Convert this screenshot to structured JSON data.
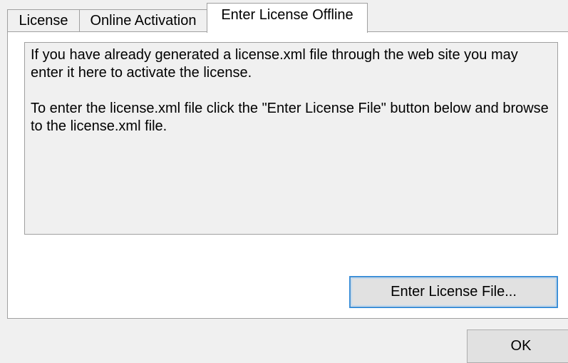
{
  "tabs": [
    {
      "label": "License",
      "selected": false
    },
    {
      "label": "Online Activation",
      "selected": false
    },
    {
      "label": "Enter License Offline",
      "selected": true
    }
  ],
  "panel": {
    "description_1": "If you have already generated a license.xml file through the web site you may enter it here to activate the license.",
    "description_2": "To enter the license.xml file click the \"Enter License File\" button below and browse to the license.xml file.",
    "enter_button_label": "Enter License File..."
  },
  "footer": {
    "ok_label": "OK"
  },
  "colors": {
    "window_background": "#f0f0f0",
    "panel_background": "#ffffff",
    "focus_border": "#3c8fd8"
  }
}
